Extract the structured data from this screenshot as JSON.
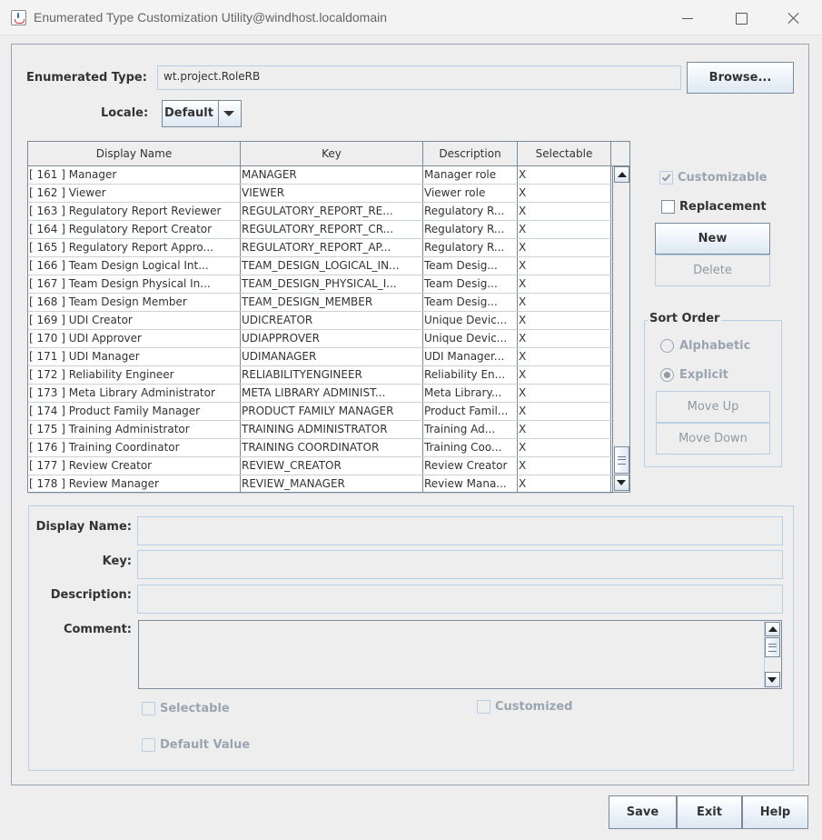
{
  "window": {
    "title": "Enumerated Type Customization Utility@windhost.localdomain"
  },
  "enum_type": {
    "label": "Enumerated Type:",
    "value": "wt.project.RoleRB",
    "browse_label": "Browse..."
  },
  "locale": {
    "label": "Locale:",
    "value": "Default"
  },
  "table": {
    "headers": [
      "Display Name",
      "Key",
      "Description",
      "Selectable"
    ],
    "rows": [
      [
        "[ 161 ]  Manager",
        "MANAGER",
        "Manager role",
        "X"
      ],
      [
        "[ 162 ]  Viewer",
        "VIEWER",
        "Viewer role",
        "X"
      ],
      [
        "[ 163 ]  Regulatory Report Reviewer",
        "REGULATORY_REPORT_RE...",
        "Regulatory R...",
        "X"
      ],
      [
        "[ 164 ]  Regulatory Report Creator",
        "REGULATORY_REPORT_CR...",
        "Regulatory R...",
        "X"
      ],
      [
        "[ 165 ]  Regulatory Report Appro...",
        "REGULATORY_REPORT_AP...",
        "Regulatory R...",
        "X"
      ],
      [
        "[ 166 ]  Team Design Logical Int...",
        "TEAM_DESIGN_LOGICAL_IN...",
        "Team Desig...",
        "X"
      ],
      [
        "[ 167 ]  Team Design Physical In...",
        "TEAM_DESIGN_PHYSICAL_I...",
        "Team Desig...",
        "X"
      ],
      [
        "[ 168 ]  Team Design Member",
        "TEAM_DESIGN_MEMBER",
        "Team Desig...",
        "X"
      ],
      [
        "[ 169 ]  UDI Creator",
        "UDICREATOR",
        "Unique Devic...",
        "X"
      ],
      [
        "[ 170 ]  UDI Approver",
        "UDIAPPROVER",
        "Unique Devic...",
        "X"
      ],
      [
        "[ 171 ]  UDI Manager",
        "UDIMANAGER",
        "UDI Manager...",
        "X"
      ],
      [
        "[ 172 ]  Reliability Engineer",
        "RELIABILITYENGINEER",
        "Reliability En...",
        "X"
      ],
      [
        "[ 173 ]  Meta Library Administrator",
        "META LIBRARY ADMINIST...",
        "Meta Library...",
        "X"
      ],
      [
        "[ 174 ]  Product Family Manager",
        "PRODUCT FAMILY MANAGER",
        "Product Famil...",
        "X"
      ],
      [
        "[ 175 ]  Training Administrator",
        "TRAINING ADMINISTRATOR",
        "Training Ad...",
        "X"
      ],
      [
        "[ 176 ]  Training Coordinator",
        "TRAINING COORDINATOR",
        "Training Coo...",
        "X"
      ],
      [
        "[ 177 ]  Review Creator",
        "REVIEW_CREATOR",
        "Review Creator",
        "X"
      ],
      [
        "[ 178 ]  Review Manager",
        "REVIEW_MANAGER",
        "Review Mana...",
        "X"
      ]
    ]
  },
  "side": {
    "customizable": "Customizable",
    "replacement": "Replacement",
    "new_label": "New",
    "delete_label": "Delete"
  },
  "sort": {
    "legend": "Sort Order",
    "alphabetic": "Alphabetic",
    "explicit": "Explicit",
    "move_up": "Move Up",
    "move_down": "Move Down"
  },
  "details": {
    "display_name_label": "Display Name:",
    "key_label": "Key:",
    "description_label": "Description:",
    "comment_label": "Comment:",
    "selectable": "Selectable",
    "customized": "Customized",
    "default_value": "Default Value"
  },
  "footer": {
    "save": "Save",
    "exit": "Exit",
    "help": "Help"
  }
}
